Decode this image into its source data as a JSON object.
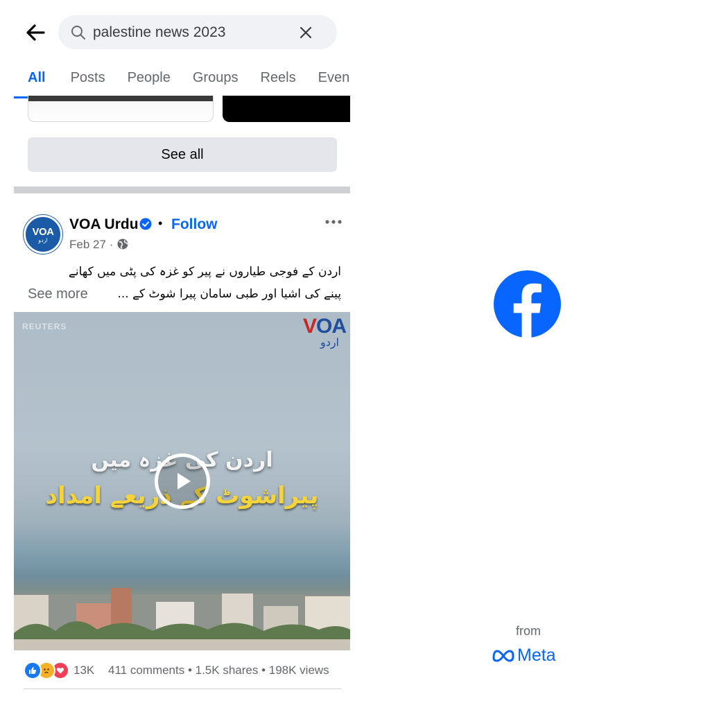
{
  "search": {
    "query": "palestine news 2023"
  },
  "tabs": [
    {
      "label": "All",
      "active": true
    },
    {
      "label": "Posts"
    },
    {
      "label": "People"
    },
    {
      "label": "Groups"
    },
    {
      "label": "Reels"
    },
    {
      "label": "Even"
    }
  ],
  "see_all_label": "See all",
  "post": {
    "page_name": "VOA Urdu",
    "separator": "•",
    "follow_label": "Follow",
    "date": "Feb 27 ·",
    "text_line1": "اردن کے فوجی طیاروں نے پیر کو غزہ کی پٹی میں کھانے",
    "text_line2": "پینے کی اشیا اور طبی سامان پیرا شوٹ کے ...",
    "see_more_label": "See more",
    "avatar_text": "VOA",
    "avatar_subtext": "اردو",
    "video": {
      "watermark": "REUTERS",
      "logo_text_v": "V",
      "logo_text_rest": "OA",
      "logo_urdu": "اردو",
      "overlay_line1": "اردن کی غزہ میں",
      "overlay_line2": "پیراشوٹ کے ذریعے امداد"
    },
    "reaction_count": "13K",
    "stats": "411 comments • 1.5K shares • 198K views",
    "reactions": [
      "like",
      "sad",
      "love"
    ]
  },
  "splash": {
    "from_label": "from",
    "brand": "Meta"
  },
  "colors": {
    "accent": "#0866ff",
    "facebook_blue": "#0866ff",
    "video_caption_yellow": "#f5d33a"
  }
}
